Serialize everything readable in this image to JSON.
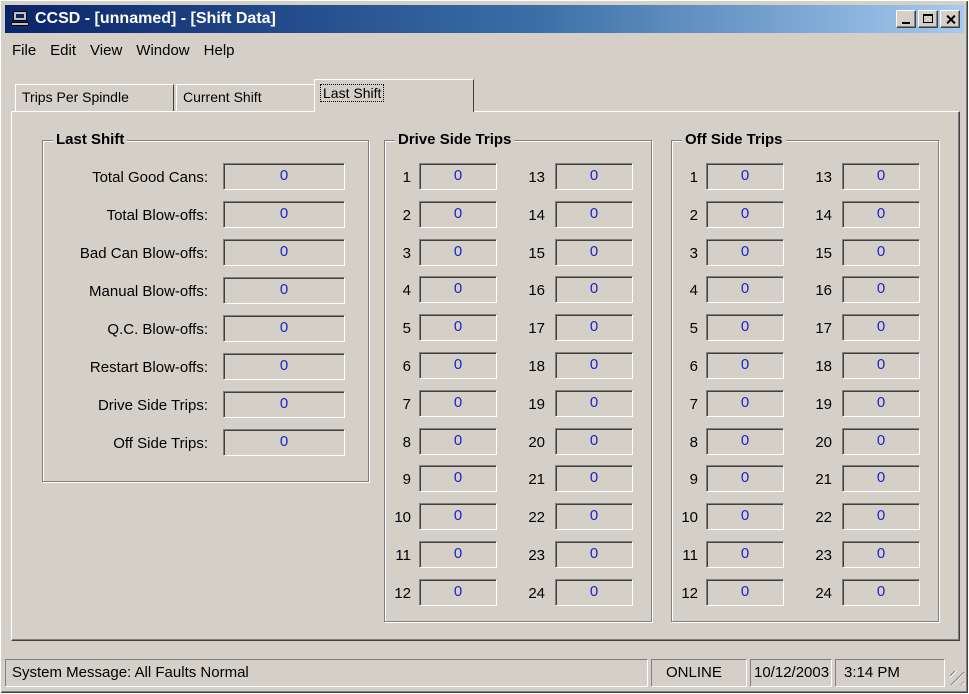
{
  "window": {
    "title": "CCSD - [unnamed] - [Shift Data]",
    "icon": "terminal-icon"
  },
  "menu": [
    "File",
    "Edit",
    "View",
    "Window",
    "Help"
  ],
  "tabs": [
    {
      "label": "Trips Per Spindle",
      "active": false
    },
    {
      "label": "Current Shift",
      "active": false
    },
    {
      "label": "Last Shift",
      "active": true
    }
  ],
  "last_shift": {
    "title": "Last Shift",
    "rows": [
      {
        "label": "Total Good Cans:",
        "value": "0"
      },
      {
        "label": "Total Blow-offs:",
        "value": "0"
      },
      {
        "label": "Bad Can Blow-offs:",
        "value": "0"
      },
      {
        "label": "Manual Blow-offs:",
        "value": "0"
      },
      {
        "label": "Q.C. Blow-offs:",
        "value": "0"
      },
      {
        "label": "Restart Blow-offs:",
        "value": "0"
      },
      {
        "label": "Drive Side Trips:",
        "value": "0"
      },
      {
        "label": "Off Side Trips:",
        "value": "0"
      }
    ]
  },
  "drive_side": {
    "title": "Drive Side Trips",
    "left": [
      {
        "n": "1",
        "v": "0"
      },
      {
        "n": "2",
        "v": "0"
      },
      {
        "n": "3",
        "v": "0"
      },
      {
        "n": "4",
        "v": "0"
      },
      {
        "n": "5",
        "v": "0"
      },
      {
        "n": "6",
        "v": "0"
      },
      {
        "n": "7",
        "v": "0"
      },
      {
        "n": "8",
        "v": "0"
      },
      {
        "n": "9",
        "v": "0"
      },
      {
        "n": "10",
        "v": "0"
      },
      {
        "n": "11",
        "v": "0"
      },
      {
        "n": "12",
        "v": "0"
      }
    ],
    "right": [
      {
        "n": "13",
        "v": "0"
      },
      {
        "n": "14",
        "v": "0"
      },
      {
        "n": "15",
        "v": "0"
      },
      {
        "n": "16",
        "v": "0"
      },
      {
        "n": "17",
        "v": "0"
      },
      {
        "n": "18",
        "v": "0"
      },
      {
        "n": "19",
        "v": "0"
      },
      {
        "n": "20",
        "v": "0"
      },
      {
        "n": "21",
        "v": "0"
      },
      {
        "n": "22",
        "v": "0"
      },
      {
        "n": "23",
        "v": "0"
      },
      {
        "n": "24",
        "v": "0"
      }
    ]
  },
  "off_side": {
    "title": "Off Side Trips",
    "left": [
      {
        "n": "1",
        "v": "0"
      },
      {
        "n": "2",
        "v": "0"
      },
      {
        "n": "3",
        "v": "0"
      },
      {
        "n": "4",
        "v": "0"
      },
      {
        "n": "5",
        "v": "0"
      },
      {
        "n": "6",
        "v": "0"
      },
      {
        "n": "7",
        "v": "0"
      },
      {
        "n": "8",
        "v": "0"
      },
      {
        "n": "9",
        "v": "0"
      },
      {
        "n": "10",
        "v": "0"
      },
      {
        "n": "11",
        "v": "0"
      },
      {
        "n": "12",
        "v": "0"
      }
    ],
    "right": [
      {
        "n": "13",
        "v": "0"
      },
      {
        "n": "14",
        "v": "0"
      },
      {
        "n": "15",
        "v": "0"
      },
      {
        "n": "16",
        "v": "0"
      },
      {
        "n": "17",
        "v": "0"
      },
      {
        "n": "18",
        "v": "0"
      },
      {
        "n": "19",
        "v": "0"
      },
      {
        "n": "20",
        "v": "0"
      },
      {
        "n": "21",
        "v": "0"
      },
      {
        "n": "22",
        "v": "0"
      },
      {
        "n": "23",
        "v": "0"
      },
      {
        "n": "24",
        "v": "0"
      }
    ]
  },
  "status": {
    "message": "System Message:  All Faults Normal",
    "connection": "ONLINE",
    "date": "10/12/2003",
    "time": "3:14 PM"
  },
  "colors": {
    "value_text": "#1f22c9",
    "titlebar_start": "#0a246a",
    "titlebar_end": "#a6caf0",
    "face": "#d4d0c8"
  }
}
